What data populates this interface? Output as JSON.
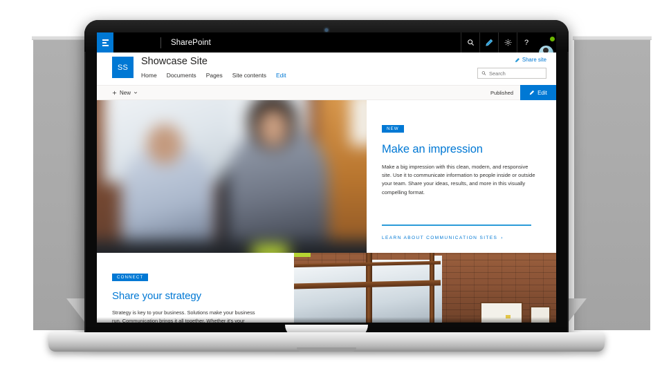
{
  "suite_bar": {
    "waffle_label": "app-launcher",
    "brand": "SharePoint",
    "actions": [
      {
        "name": "search-icon",
        "label": "Search"
      },
      {
        "name": "pencil-icon",
        "label": "Feedback"
      },
      {
        "name": "gear-icon",
        "label": "Settings"
      },
      {
        "name": "help-icon",
        "label": "?"
      }
    ],
    "avatar_label": "Account manager",
    "presence": "available"
  },
  "site_header": {
    "logo_initials": "SS",
    "title": "Showcase Site",
    "nav": [
      {
        "label": "Home",
        "active": false
      },
      {
        "label": "Documents",
        "active": false
      },
      {
        "label": "Pages",
        "active": false
      },
      {
        "label": "Site contents",
        "active": false
      },
      {
        "label": "Edit",
        "active": true
      }
    ],
    "share_site_label": "Share site",
    "search_placeholder": "Search",
    "search_value": ""
  },
  "command_bar": {
    "new_label": "New",
    "publish_status": "Published",
    "edit_label": "Edit"
  },
  "hero": {
    "badge": "NEW",
    "title": "Make an impression",
    "body": "Make a big impression with this clean, modern, and responsive site. Use it to communicate information to people inside or outside your team. Share your ideas, results, and more in this visually compelling format.",
    "cta_label": "LEARN ABOUT COMMUNICATION SITES",
    "cta_chevron": "›",
    "image_alt": "Blurred photo of colleagues meeting in a brick-walled office"
  },
  "section_two": {
    "badge": "CONNECT",
    "title": "Share your strategy",
    "body": "Strategy is key to your business. Solutions make your business run. Communication brings it all together. Whether it's your",
    "image_alt": "Brick wall with large wood-framed office windows"
  },
  "colors": {
    "brand_blue": "#0078d4",
    "link_blue": "#2a9bd8",
    "suite_bar": "#000000",
    "command_bar": "#faf9f8",
    "text": "#323130",
    "presence_green": "#6bb700"
  }
}
